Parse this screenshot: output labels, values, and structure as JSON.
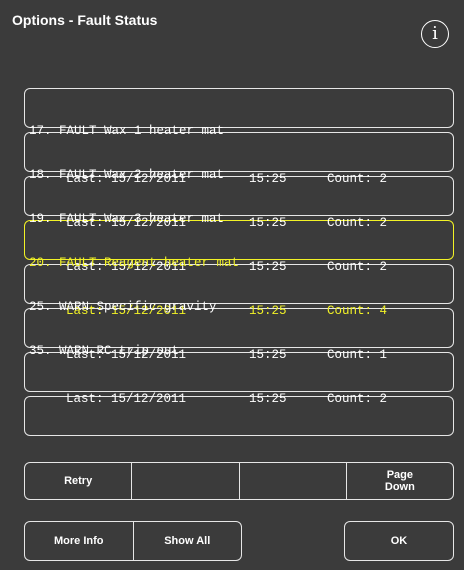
{
  "window": {
    "title": "Options - Fault Status",
    "info_icon": "info-icon",
    "info_glyph": "i"
  },
  "colors": {
    "background": "#3b3b3b",
    "text": "#ffffff",
    "highlight": "#f2f226",
    "border": "#e6e6e6"
  },
  "faults": [
    {
      "line1": "17. FAULT Wax 1 heater mat",
      "last": "Last: 15/12/2011",
      "time": "15:25",
      "count": "Count: 2",
      "highlighted": false
    },
    {
      "line1": "18. FAULT Wax 2 heater mat",
      "last": "Last: 15/12/2011",
      "time": "15:25",
      "count": "Count: 2",
      "highlighted": false
    },
    {
      "line1": "19. FAULT Wax 3 heater mat",
      "last": "Last: 15/12/2011",
      "time": "15:25",
      "count": "Count: 2",
      "highlighted": false
    },
    {
      "line1": "20. FAULT Reagent heater mat",
      "last": "Last: 15/12/2011",
      "time": "15:25",
      "count": "Count: 4",
      "highlighted": true
    },
    {
      "line1": "25. WARN Specific gravity",
      "last": "Last: 15/12/2011",
      "time": "15:25",
      "count": "Count: 1",
      "highlighted": false
    },
    {
      "line1": "35. WARN RC trip out",
      "last": "Last: 15/12/2011",
      "time": "15:25",
      "count": "Count: 2",
      "highlighted": false
    },
    {
      "line1": "",
      "last": "",
      "time": "",
      "count": "",
      "highlighted": false
    },
    {
      "line1": "",
      "last": "",
      "time": "",
      "count": "",
      "highlighted": false
    }
  ],
  "toolbar1": {
    "retry": "Retry",
    "blank1": "",
    "blank2": "",
    "page_down": "Page\nDown"
  },
  "toolbar2": {
    "more_info": "More Info",
    "show_all": "Show All"
  },
  "ok": "OK"
}
